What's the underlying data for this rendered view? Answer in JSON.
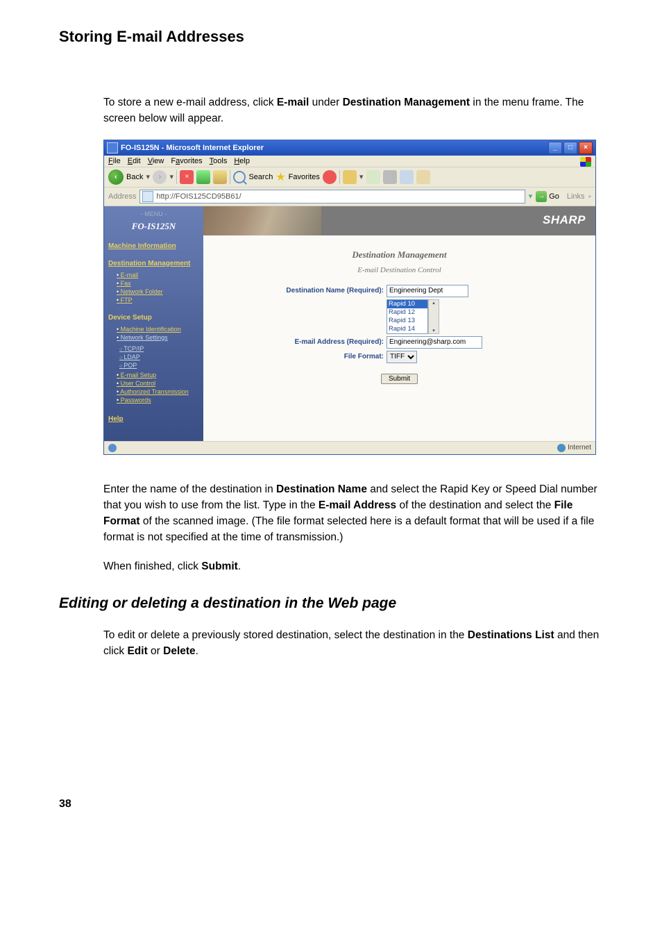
{
  "page": {
    "title": "Storing E-mail Addresses",
    "page_number": "38"
  },
  "paragraphs": {
    "intro_1": "To store a new e-mail address, click ",
    "intro_b1": "E-mail",
    "intro_2": " under ",
    "intro_b2": "Destination Management",
    "intro_3": " in the menu frame. The screen below will appear.",
    "after1_1": "Enter the name of the destination in ",
    "after1_b1": "Destination Name",
    "after1_2": " and select the Rapid Key or Speed Dial number that you wish to use from the list. Type in the ",
    "after1_b2": "E-mail Address",
    "after1_3": " of the destination and select the ",
    "after1_b3": "File Format",
    "after1_4": " of the scanned image. (The file format selected here is a default format that will be used if a file format is not specified at the time of transmission.)",
    "after2_1": "When finished, click ",
    "after2_b1": "Submit",
    "after2_2": ".",
    "section2_title": "Editing or deleting a destination in the Web page",
    "sec2_p_1": "To edit or delete a previously stored destination, select the destination in the ",
    "sec2_p_b1": "Destinations List",
    "sec2_p_2": " and then click ",
    "sec2_p_b2": "Edit",
    "sec2_p_3": " or ",
    "sec2_p_b3": "Delete",
    "sec2_p_4": "."
  },
  "browser": {
    "title": "FO-IS125N - Microsoft Internet Explorer",
    "menus": {
      "file": "File",
      "edit": "Edit",
      "view": "View",
      "favorites": "Favorites",
      "tools": "Tools",
      "help": "Help"
    },
    "toolbar": {
      "back": "Back",
      "search": "Search",
      "favorites": "Favorites"
    },
    "address": {
      "label": "Address",
      "url": "http://FOIS125CD95B61/",
      "go": "Go",
      "links": "Links"
    },
    "sidebar": {
      "menu_label": "- MENU -",
      "device": "FO-IS125N",
      "machine_info": "Machine Information",
      "dest_mgmt": "Destination Management",
      "dest_items": {
        "email": "E-mail",
        "fax": "Fax",
        "network_folder": "Network Folder",
        "ftp": "FTP"
      },
      "device_setup": "Device Setup",
      "device_items": {
        "machine_id": "Machine Identification",
        "network_settings": "Network Settings",
        "tcpip": "TCP/IP",
        "ldap": "LDAP",
        "pop": "POP",
        "email_setup": "E-mail Setup",
        "user_control": "User Control",
        "auth_trans": "Authorized Transmission",
        "passwords": "Passwords"
      },
      "help": "Help"
    },
    "main": {
      "brand": "SHARP",
      "title": "Destination Management",
      "subtitle": "E-mail Destination Control",
      "labels": {
        "dest_name": "Destination Name (Required):",
        "email_addr": "E-mail Address (Required):",
        "file_format": "File Format:"
      },
      "values": {
        "dest_name": "Engineering Dept",
        "email_addr": "Engineering@sharp.com",
        "file_format": "TIFF"
      },
      "rapid_options": [
        "Rapid 10",
        "Rapid 12",
        "Rapid 13",
        "Rapid 14"
      ],
      "submit": "Submit"
    },
    "status": {
      "zone": "Internet"
    }
  }
}
